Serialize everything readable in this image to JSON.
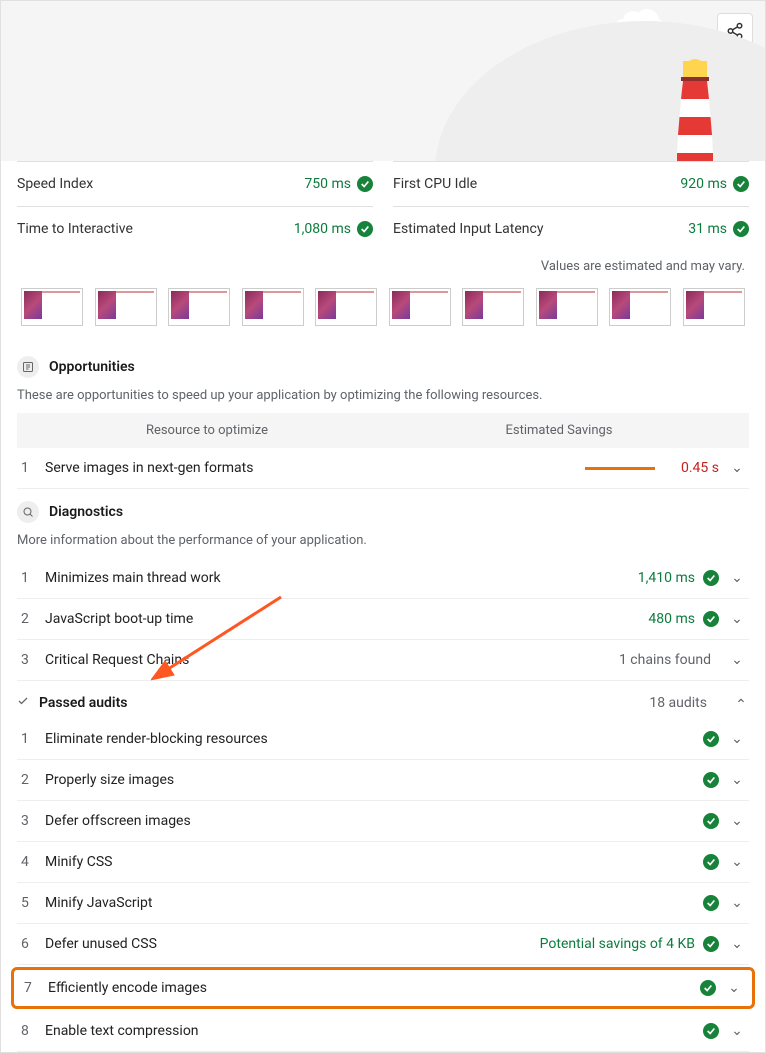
{
  "icons": {
    "share": "share-icon",
    "opp": "opportunities-icon",
    "diag": "diagnostics-icon",
    "check": "check-icon"
  },
  "metrics_left": [
    {
      "label": "Speed Index",
      "value": "750 ms"
    },
    {
      "label": "Time to Interactive",
      "value": "1,080 ms"
    }
  ],
  "metrics_right": [
    {
      "label": "First CPU Idle",
      "value": "920 ms"
    },
    {
      "label": "Estimated Input Latency",
      "value": "31 ms"
    }
  ],
  "estimate_note": "Values are estimated and may vary.",
  "filmstrip_count": 10,
  "opportunities": {
    "title": "Opportunities",
    "desc": "These are opportunities to speed up your application by optimizing the following resources.",
    "col_resource": "Resource to optimize",
    "col_savings": "Estimated Savings",
    "items": [
      {
        "n": "1",
        "label": "Serve images in next-gen formats",
        "savings": "0.45 s"
      }
    ]
  },
  "diagnostics": {
    "title": "Diagnostics",
    "desc": "More information about the performance of your application.",
    "items": [
      {
        "n": "1",
        "label": "Minimizes main thread work",
        "value": "1,410 ms",
        "pass": true
      },
      {
        "n": "2",
        "label": "JavaScript boot-up time",
        "value": "480 ms",
        "pass": true
      },
      {
        "n": "3",
        "label": "Critical Request Chains",
        "value": "1 chains found",
        "neutral": true
      }
    ]
  },
  "passed": {
    "title": "Passed audits",
    "count": "18 audits",
    "items": [
      {
        "n": "1",
        "label": "Eliminate render-blocking resources",
        "note": ""
      },
      {
        "n": "2",
        "label": "Properly size images",
        "note": ""
      },
      {
        "n": "3",
        "label": "Defer offscreen images",
        "note": ""
      },
      {
        "n": "4",
        "label": "Minify CSS",
        "note": ""
      },
      {
        "n": "5",
        "label": "Minify JavaScript",
        "note": ""
      },
      {
        "n": "6",
        "label": "Defer unused CSS",
        "note": "Potential savings of 4 KB"
      },
      {
        "n": "7",
        "label": "Efficiently encode images",
        "note": "",
        "highlight": true
      },
      {
        "n": "8",
        "label": "Enable text compression",
        "note": ""
      }
    ]
  }
}
